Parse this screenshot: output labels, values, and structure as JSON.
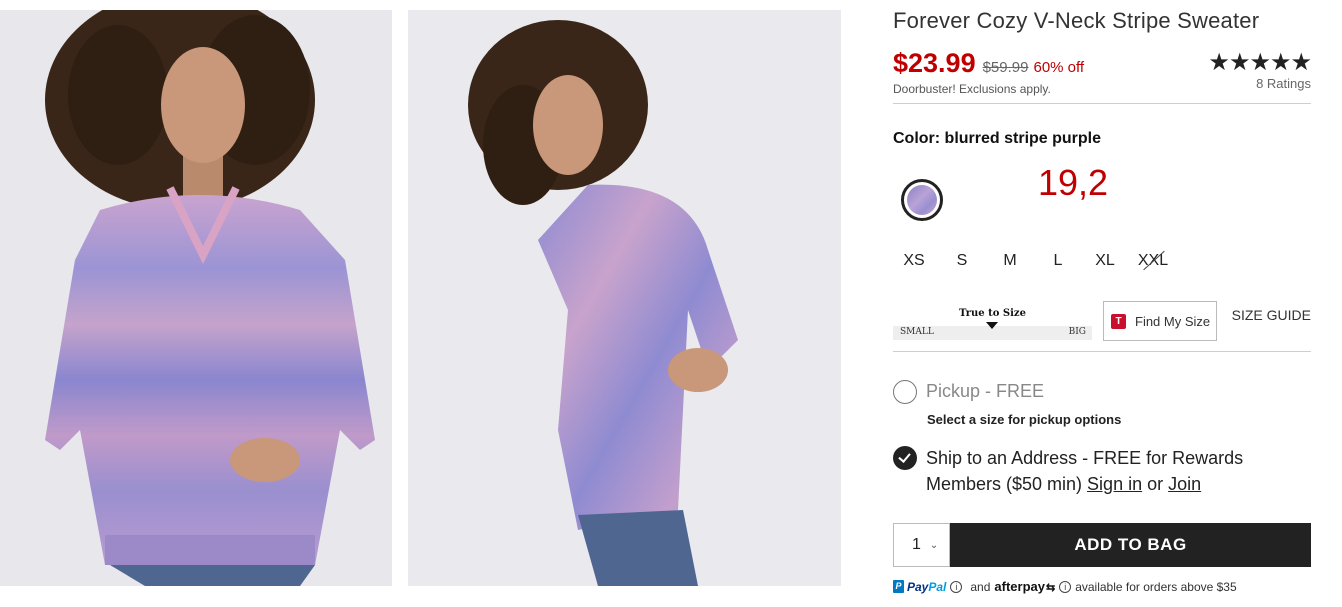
{
  "product": {
    "title": "Forever Cozy V-Neck Stripe Sweater",
    "sale_price": "$23.99",
    "original_price": "$59.99",
    "discount": "60% off",
    "promo_note": "Doorbuster! Exclusions apply.",
    "rating_stars": "★★★★★",
    "rating_value": 4.5,
    "ratings_count": "8 Ratings"
  },
  "color": {
    "label": "Color: blurred stripe purple",
    "overlay_text": "19,2"
  },
  "sizes": [
    {
      "label": "XS",
      "available": true
    },
    {
      "label": "S",
      "available": true
    },
    {
      "label": "M",
      "available": true
    },
    {
      "label": "L",
      "available": true
    },
    {
      "label": "XL",
      "available": true
    },
    {
      "label": "XXL",
      "available": false
    }
  ],
  "fit": {
    "title": "True to Size",
    "small_label": "SMALL",
    "big_label": "BIG",
    "find_my_size": "Find My Size",
    "find_my_size_icon": "T",
    "size_guide": "SIZE GUIDE"
  },
  "fulfillment": {
    "pickup_label": "Pickup",
    "pickup_free": " - FREE",
    "pickup_sub": "Select a size for pickup options",
    "ship_prefix": "Ship to an Address - FREE for Rewards Members ($50 min) ",
    "sign_in": "Sign in",
    "or": " or ",
    "join": "Join"
  },
  "purchase": {
    "quantity": "1",
    "add_to_bag": "ADD TO BAG"
  },
  "payments": {
    "paypal_pay": "Pay",
    "paypal_pal": "Pal",
    "and": "and",
    "afterpay": "afterpay",
    "available_text": "available for orders above $35"
  },
  "colors": {
    "sale": "#c00000",
    "button_bg": "#222222",
    "paypal_blue": "#003087"
  }
}
